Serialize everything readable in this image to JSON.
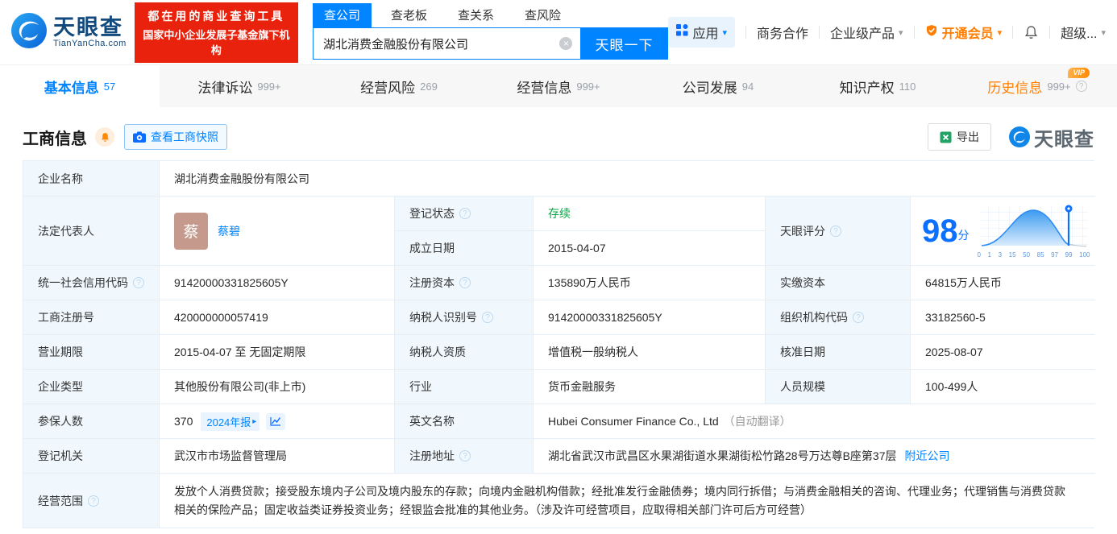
{
  "brand": {
    "name": "天眼查",
    "domain": "TianYanCha.com",
    "slogan1": "都在用的商业查询工具",
    "slogan2": "国家中小企业发展子基金旗下机构"
  },
  "search": {
    "tabs": [
      "查公司",
      "查老板",
      "查关系",
      "查风险"
    ],
    "value": "湖北消费金融股份有限公司",
    "button": "天眼一下"
  },
  "topnav": {
    "apps": "应用",
    "biz": "商务合作",
    "enterprise": "企业级产品",
    "vip": "开通会员",
    "super": "超级..."
  },
  "tabs": [
    {
      "label": "基本信息",
      "count": "57"
    },
    {
      "label": "法律诉讼",
      "count": "999+"
    },
    {
      "label": "经营风险",
      "count": "269"
    },
    {
      "label": "经营信息",
      "count": "999+"
    },
    {
      "label": "公司发展",
      "count": "94"
    },
    {
      "label": "知识产权",
      "count": "110"
    },
    {
      "label": "历史信息",
      "count": "999+",
      "badge": "VIP"
    }
  ],
  "section": {
    "title": "工商信息",
    "snapshot": "查看工商快照",
    "export": "导出",
    "watermark": "天眼查"
  },
  "score": {
    "label": "天眼评分",
    "value": "98",
    "unit": "分",
    "axis": [
      "0",
      "1",
      "3",
      "15",
      "50",
      "85",
      "97",
      "99",
      "100"
    ]
  },
  "fields": {
    "company_name": {
      "label": "企业名称",
      "value": "湖北消费金融股份有限公司"
    },
    "legal_rep": {
      "label": "法定代表人",
      "avatar": "蔡",
      "name": "蔡碧"
    },
    "reg_status": {
      "label": "登记状态",
      "value": "存续"
    },
    "establish_date": {
      "label": "成立日期",
      "value": "2015-04-07"
    },
    "credit_code": {
      "label": "统一社会信用代码",
      "value": "91420000331825605Y"
    },
    "reg_capital": {
      "label": "注册资本",
      "value": "135890万人民币"
    },
    "paid_capital": {
      "label": "实缴资本",
      "value": "64815万人民币"
    },
    "reg_number": {
      "label": "工商注册号",
      "value": "420000000057419"
    },
    "taxpayer_id": {
      "label": "纳税人识别号",
      "value": "91420000331825605Y"
    },
    "org_code": {
      "label": "组织机构代码",
      "value": "33182560-5"
    },
    "business_term": {
      "label": "营业期限",
      "value": "2015-04-07 至 无固定期限"
    },
    "taxpayer_quality": {
      "label": "纳税人资质",
      "value": "增值税一般纳税人"
    },
    "approval_date": {
      "label": "核准日期",
      "value": "2025-08-07"
    },
    "company_type": {
      "label": "企业类型",
      "value": "其他股份有限公司(非上市)"
    },
    "industry": {
      "label": "行业",
      "value": "货币金融服务"
    },
    "staff_size": {
      "label": "人员规模",
      "value": "100-499人"
    },
    "insured": {
      "label": "参保人数",
      "value": "370",
      "tag": "2024年报"
    },
    "english_name": {
      "label": "英文名称",
      "value": "Hubei Consumer Finance Co., Ltd",
      "note": "（自动翻译）"
    },
    "reg_authority": {
      "label": "登记机关",
      "value": "武汉市市场监督管理局"
    },
    "reg_address": {
      "label": "注册地址",
      "value": "湖北省武汉市武昌区水果湖街道水果湖街松竹路28号万达尊B座第37层",
      "link": "附近公司"
    },
    "business_scope": {
      "label": "经营范围",
      "value": "发放个人消费贷款；接受股东境内子公司及境内股东的存款；向境内金融机构借款；经批准发行金融债券；境内同行拆借；与消费金融相关的咨询、代理业务；代理销售与消费贷款相关的保险产品；固定收益类证券投资业务；经银监会批准的其他业务。（涉及许可经营项目，应取得相关部门许可后方可经营）"
    }
  }
}
